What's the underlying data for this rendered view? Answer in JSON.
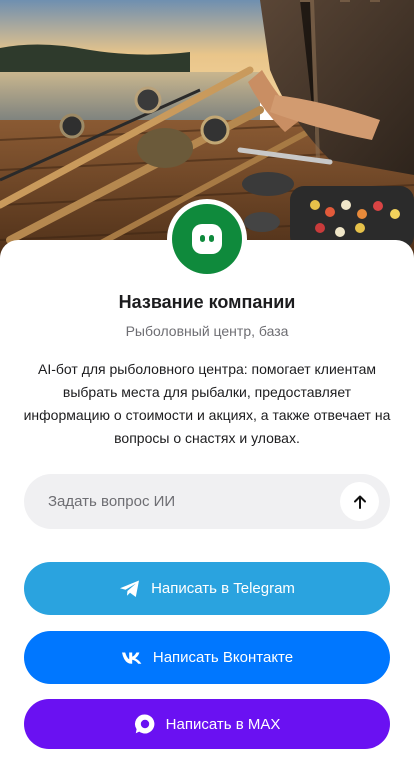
{
  "hero": {
    "image": "fishing-gear-photo"
  },
  "company": {
    "avatar_icon": "chat-bot-icon",
    "avatar_color": "#0f8a3c",
    "name": "Название компании",
    "category": "Рыболовный центр, база",
    "description": "AI-бот для рыболовного центра: помогает клиентам выбрать места для рыбалки, предоставляет информацию о стоимости и акциях, а также отвечает на вопросы о снастях и уловах."
  },
  "ask": {
    "placeholder": "Задать вопрос ИИ",
    "value": "",
    "send_icon": "arrow-up-icon"
  },
  "actions": [
    {
      "label": "Написать в Telegram",
      "icon": "telegram-icon",
      "color": "#2aa3df"
    },
    {
      "label": "Написать Вконтакте",
      "icon": "vk-icon",
      "color": "#0077ff"
    },
    {
      "label": "Написать в MAX",
      "icon": "max-icon",
      "color": "#6a11f2"
    }
  ]
}
